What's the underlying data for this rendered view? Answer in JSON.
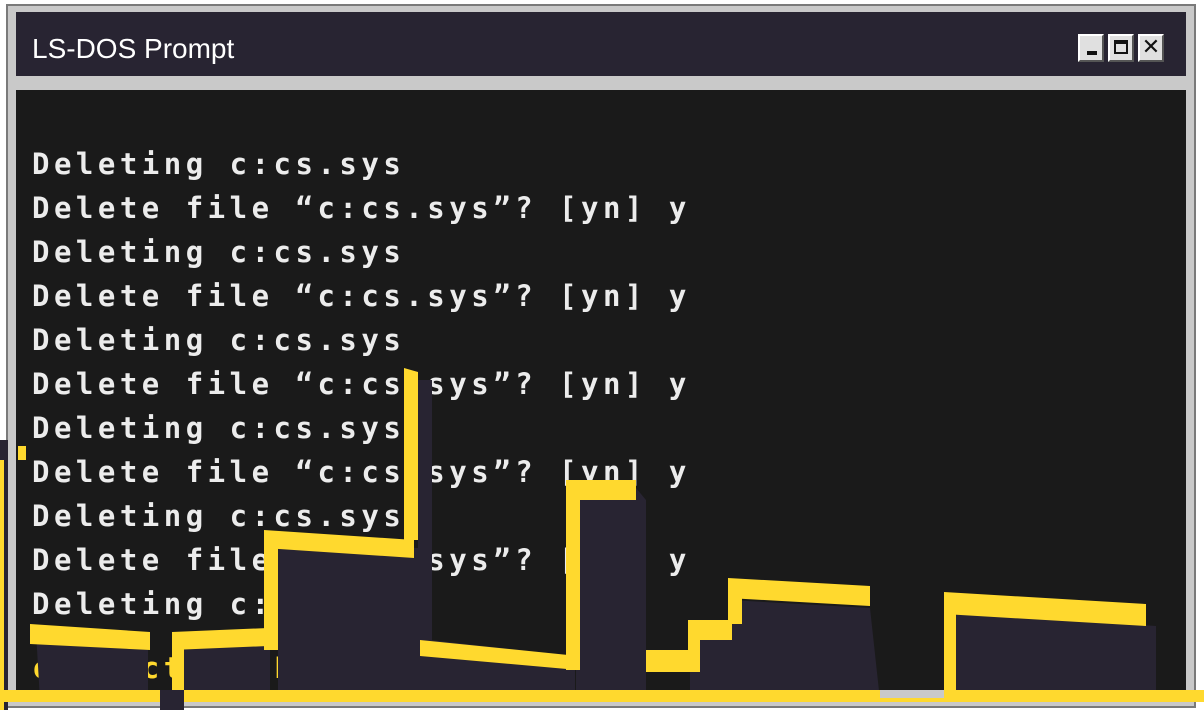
{
  "window": {
    "title": "LS-DOS Prompt",
    "controls": {
      "minimize_icon": "minimize-icon",
      "maximize_icon": "maximize-icon",
      "close_icon": "close-icon",
      "close_glyph": "✕"
    }
  },
  "terminal": {
    "lines": [
      "Deleting c:cs.sys",
      "Delete file “c:cs.sys”? [yn] y",
      "Deleting c:cs.sys",
      "Delete file “c:cs.sys”? [yn] y",
      "Deleting c:cs.sys",
      "Delete file “c:cs.sys”? [yn] y",
      "Deleting c:cs.sys",
      "Delete file “c:cs.sys”? [yn] y",
      "Deleting c:cs.sys",
      "Delete file “c:cs.sys”? [yn] y",
      "Deleting c:cs.sys"
    ],
    "prompt": "c:> Active LeetOS.exe"
  },
  "colors": {
    "window_frame": "#c9c9c9",
    "titlebar": "#282432",
    "terminal_bg": "#1a1a1a",
    "terminal_text": "#ececec",
    "accent_yellow": "#ffd92e",
    "building_dark": "#282432"
  },
  "decoration": {
    "skyline_icon": "city-skyline-graphic"
  }
}
